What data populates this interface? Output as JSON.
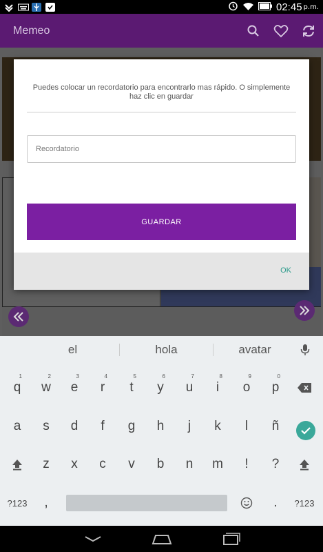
{
  "status_bar": {
    "time": "02:45",
    "ampm": "p.m."
  },
  "app_bar": {
    "title": "Memeo"
  },
  "dialog": {
    "message": "Puedes colocar un recordatorio para encontrarlo mas rápido. O simplemente haz clic en guardar",
    "input": {
      "placeholder": "Recordatorio",
      "value": ""
    },
    "save_label": "GUARDAR",
    "ok_label": "OK"
  },
  "keyboard": {
    "suggestions": [
      "el",
      "hola",
      "avatar"
    ],
    "row1": [
      {
        "key": "q",
        "hint": "1"
      },
      {
        "key": "w",
        "hint": "2"
      },
      {
        "key": "e",
        "hint": "3"
      },
      {
        "key": "r",
        "hint": "4"
      },
      {
        "key": "t",
        "hint": "5"
      },
      {
        "key": "y",
        "hint": "6"
      },
      {
        "key": "u",
        "hint": "7"
      },
      {
        "key": "i",
        "hint": "8"
      },
      {
        "key": "o",
        "hint": "9"
      },
      {
        "key": "p",
        "hint": "0"
      }
    ],
    "row2": [
      "a",
      "s",
      "d",
      "f",
      "g",
      "h",
      "j",
      "k",
      "l",
      "ñ"
    ],
    "row3": [
      "z",
      "x",
      "c",
      "v",
      "b",
      "n",
      "m",
      "!",
      "?"
    ],
    "row4": {
      "symbols_left": "?123",
      "comma": ",",
      "period": ".",
      "symbols_right": "?123"
    }
  },
  "icons": {
    "search": "search-icon",
    "favorite": "heart-icon",
    "refresh": "refresh-icon",
    "prev": "chevron-double-left-icon",
    "next": "chevron-double-right-icon",
    "mic": "mic-icon",
    "backspace": "backspace-icon",
    "enter": "check-icon",
    "shift": "shift-icon",
    "emoji": "emoji-icon",
    "nav_back": "back-icon",
    "nav_home": "home-icon",
    "nav_recents": "recents-icon"
  },
  "colors": {
    "primary": "#5b1a72",
    "button": "#7b1fa2",
    "accent": "#2a9a8a",
    "enter_key": "#3aa89a"
  }
}
